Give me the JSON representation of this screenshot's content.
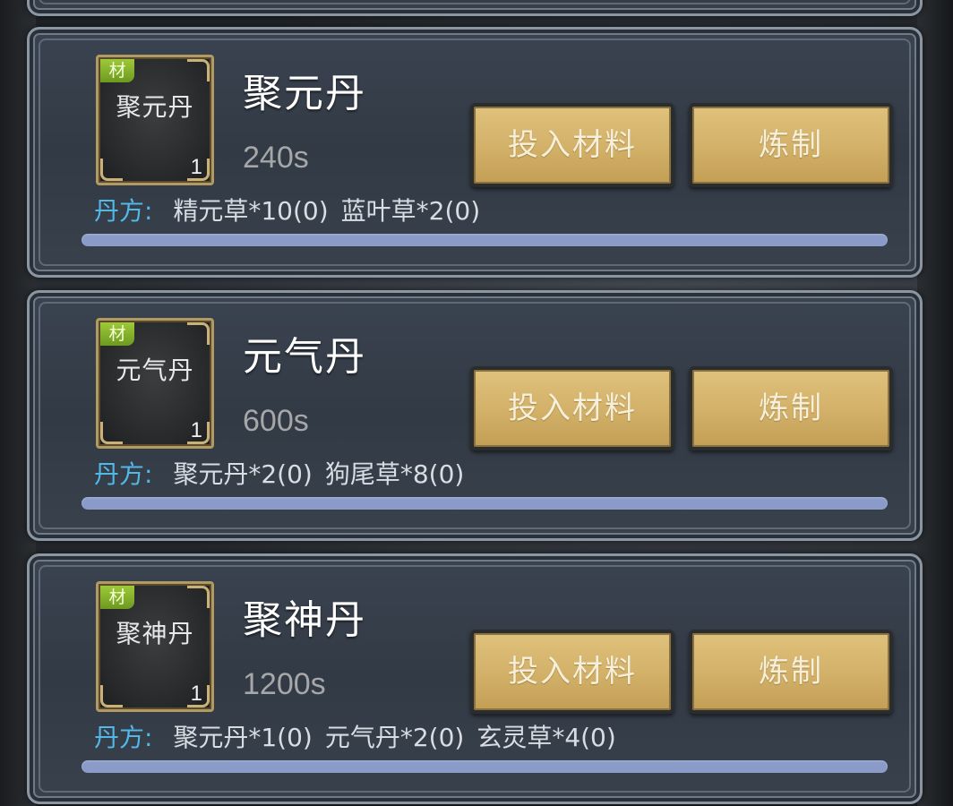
{
  "recipe_label": "丹方:",
  "badge_label": "材",
  "feed_button_label": "投入材料",
  "refine_button_label": "炼制",
  "pills": [
    {
      "name": "聚元丹",
      "icon_name": "聚元丹",
      "count": "1",
      "time": "240s",
      "ingredients": [
        "精元草*10(0)",
        "蓝叶草*2(0)"
      ],
      "progress": 0
    },
    {
      "name": "元气丹",
      "icon_name": "元气丹",
      "count": "1",
      "time": "600s",
      "ingredients": [
        "聚元丹*2(0)",
        "狗尾草*8(0)"
      ],
      "progress": 0
    },
    {
      "name": "聚神丹",
      "icon_name": "聚神丹",
      "count": "1",
      "time": "1200s",
      "ingredients": [
        "聚元丹*1(0)",
        "元气丹*2(0)",
        "玄灵草*4(0)"
      ],
      "progress": 0
    }
  ],
  "colors": {
    "recipe_label": "#52b8e8",
    "button_gold": "#d2b068",
    "badge_green": "#8cbb2e",
    "progress_track": "#8b9bc9"
  }
}
